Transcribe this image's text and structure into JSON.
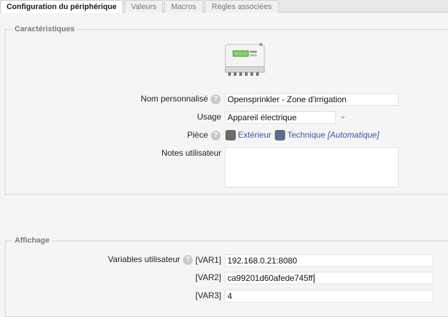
{
  "tabs": [
    {
      "label": "Configuration du périphérique",
      "active": true
    },
    {
      "label": "Valeurs",
      "active": false
    },
    {
      "label": "Macros",
      "active": false
    },
    {
      "label": "Règles associées",
      "active": false
    }
  ],
  "characteristics": {
    "legend": "Caractéristiques",
    "device_icon": "sprinkler-controller-device-icon",
    "name_label": "Nom personnalisé",
    "name_value": "Opensprinkler - Zone d'irrigation",
    "usage_label": "Usage",
    "usage_value": "Appareil électrique",
    "room_label": "Pièce",
    "room_primary": "Extérieur",
    "room_secondary": "Technique",
    "room_auto": "[Automatique]",
    "notes_label": "Notes utilisateur",
    "notes_value": ""
  },
  "display": {
    "legend": "Affichage",
    "vars_label": "Variables utilisateur",
    "vars": [
      {
        "label": "[VAR1]",
        "value": "192.168.0.21:8080"
      },
      {
        "label": "[VAR2]",
        "value": "ca99201d60afede745ff"
      },
      {
        "label": "[VAR3]",
        "value": "4"
      }
    ]
  },
  "colors": {
    "link": "#3a55a8",
    "legend": "#7a7a7a",
    "help_icon": "#c9c9c9"
  }
}
